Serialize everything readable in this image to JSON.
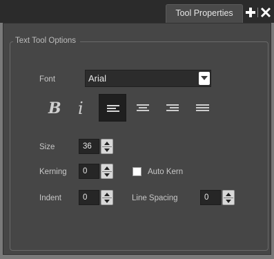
{
  "panel": {
    "tab_label": "Tool Properties",
    "add_icon": "plus-icon",
    "close_icon": "close-icon"
  },
  "group": {
    "legend": "Text Tool Options"
  },
  "font": {
    "label": "Font",
    "selected": "Arial"
  },
  "style_buttons": [
    {
      "name": "bold",
      "glyph": "B",
      "active": false
    },
    {
      "name": "italic",
      "glyph": "i",
      "active": false
    },
    {
      "name": "align-left",
      "active": true
    },
    {
      "name": "align-center",
      "active": false
    },
    {
      "name": "align-right",
      "active": false
    },
    {
      "name": "justify",
      "active": false
    }
  ],
  "size": {
    "label": "Size",
    "value": "36"
  },
  "kerning": {
    "label": "Kerning",
    "value": "0"
  },
  "auto_kern": {
    "label": "Auto Kern",
    "checked": false
  },
  "indent": {
    "label": "Indent",
    "value": "0"
  },
  "line_spacing": {
    "label": "Line Spacing",
    "value": "0"
  },
  "colors": {
    "panel_bg": "#464646",
    "field_bg": "#262626",
    "active_button_bg": "#1f1f1f",
    "text": "#cfcfcf"
  }
}
